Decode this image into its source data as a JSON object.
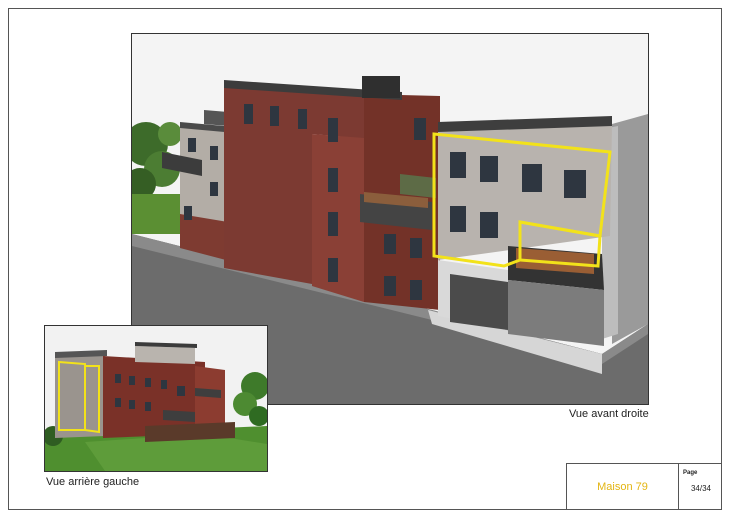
{
  "views": {
    "main_caption": "Vue avant droite",
    "inset_caption": "Vue arrière gauche"
  },
  "title_block": {
    "project_name": "Maison 79",
    "page_label": "Page",
    "page_number": "34/34"
  },
  "colors": {
    "highlight_outline": "#f2e21a",
    "project_name": "#e3b512",
    "brick": "#7a2e28",
    "grey_cladding": "#b8b3ae",
    "road": "#6f6f6f",
    "roof": "#3e3e3e",
    "lawn": "#4f8f2f"
  }
}
